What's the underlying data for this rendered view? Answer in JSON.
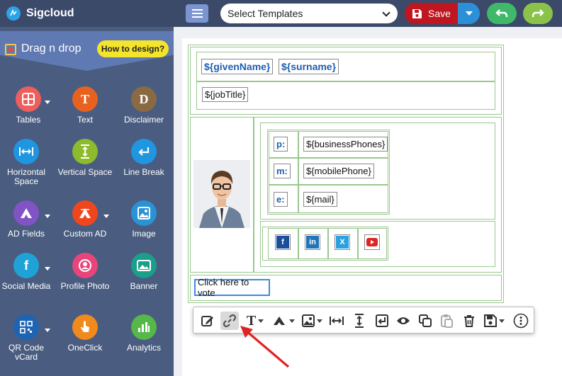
{
  "app": {
    "name": "Sigcloud"
  },
  "sidebar": {
    "heading": "Drag n drop",
    "how_button": "How to design?",
    "tools": [
      {
        "label": "Tables",
        "icon": "tables-icon",
        "color": "#ef5d5d"
      },
      {
        "label": "Text",
        "icon": "text-icon",
        "color": "#e8621f"
      },
      {
        "label": "Disclaimer",
        "icon": "disclaimer-icon",
        "color": "#8a6a43"
      },
      {
        "label": "Horizontal Space",
        "icon": "horizontal-space-icon",
        "color": "#2196e0"
      },
      {
        "label": "Vertical Space",
        "icon": "vertical-space-icon",
        "color": "#8dbb2c"
      },
      {
        "label": "Line Break",
        "icon": "line-break-icon",
        "color": "#2196e0"
      },
      {
        "label": "AD Fields",
        "icon": "ad-fields-icon",
        "color": "#8253c4"
      },
      {
        "label": "Custom AD",
        "icon": "custom-ad-icon",
        "color": "#f0461e"
      },
      {
        "label": "Image",
        "icon": "image-icon",
        "color": "#2a93d5"
      },
      {
        "label": "Social Media",
        "icon": "social-media-icon",
        "color": "#1fa2d6"
      },
      {
        "label": "Profile Photo",
        "icon": "profile-photo-icon",
        "color": "#e9457a"
      },
      {
        "label": "Banner",
        "icon": "banner-icon",
        "color": "#1a9f8a"
      },
      {
        "label": "QR Code vCard",
        "icon": "qr-code-icon",
        "color": "#1e64b5"
      },
      {
        "label": "OneClick",
        "icon": "oneclick-icon",
        "color": "#f08a1c"
      },
      {
        "label": "Analytics",
        "icon": "analytics-icon",
        "color": "#55b848"
      }
    ]
  },
  "topbar": {
    "template_select": "Select Templates",
    "save_label": "Save"
  },
  "signature": {
    "given_name": "${givenName}",
    "surname": "${surname}",
    "job_title": "${jobTitle}",
    "contacts": [
      {
        "label": "p:",
        "value": "${businessPhones}"
      },
      {
        "label": "m:",
        "value": "${mobilePhone}"
      },
      {
        "label": "e:",
        "value": "${mail}"
      }
    ],
    "socials": [
      {
        "icon": "facebook-icon",
        "glyph": "f",
        "color": "#1b4f9c"
      },
      {
        "icon": "linkedin-icon",
        "glyph": "in",
        "color": "#1f75b8"
      },
      {
        "icon": "twitter-x-icon",
        "glyph": "𝕏",
        "color": "#2aa0dc"
      },
      {
        "icon": "youtube-icon",
        "glyph": "▶",
        "color": "#e02424"
      }
    ],
    "vote_text": "Click here to vote"
  },
  "colors": {
    "accent": "#3b8ad9",
    "table_border": "#9ac78f",
    "save": "#c0161f"
  }
}
